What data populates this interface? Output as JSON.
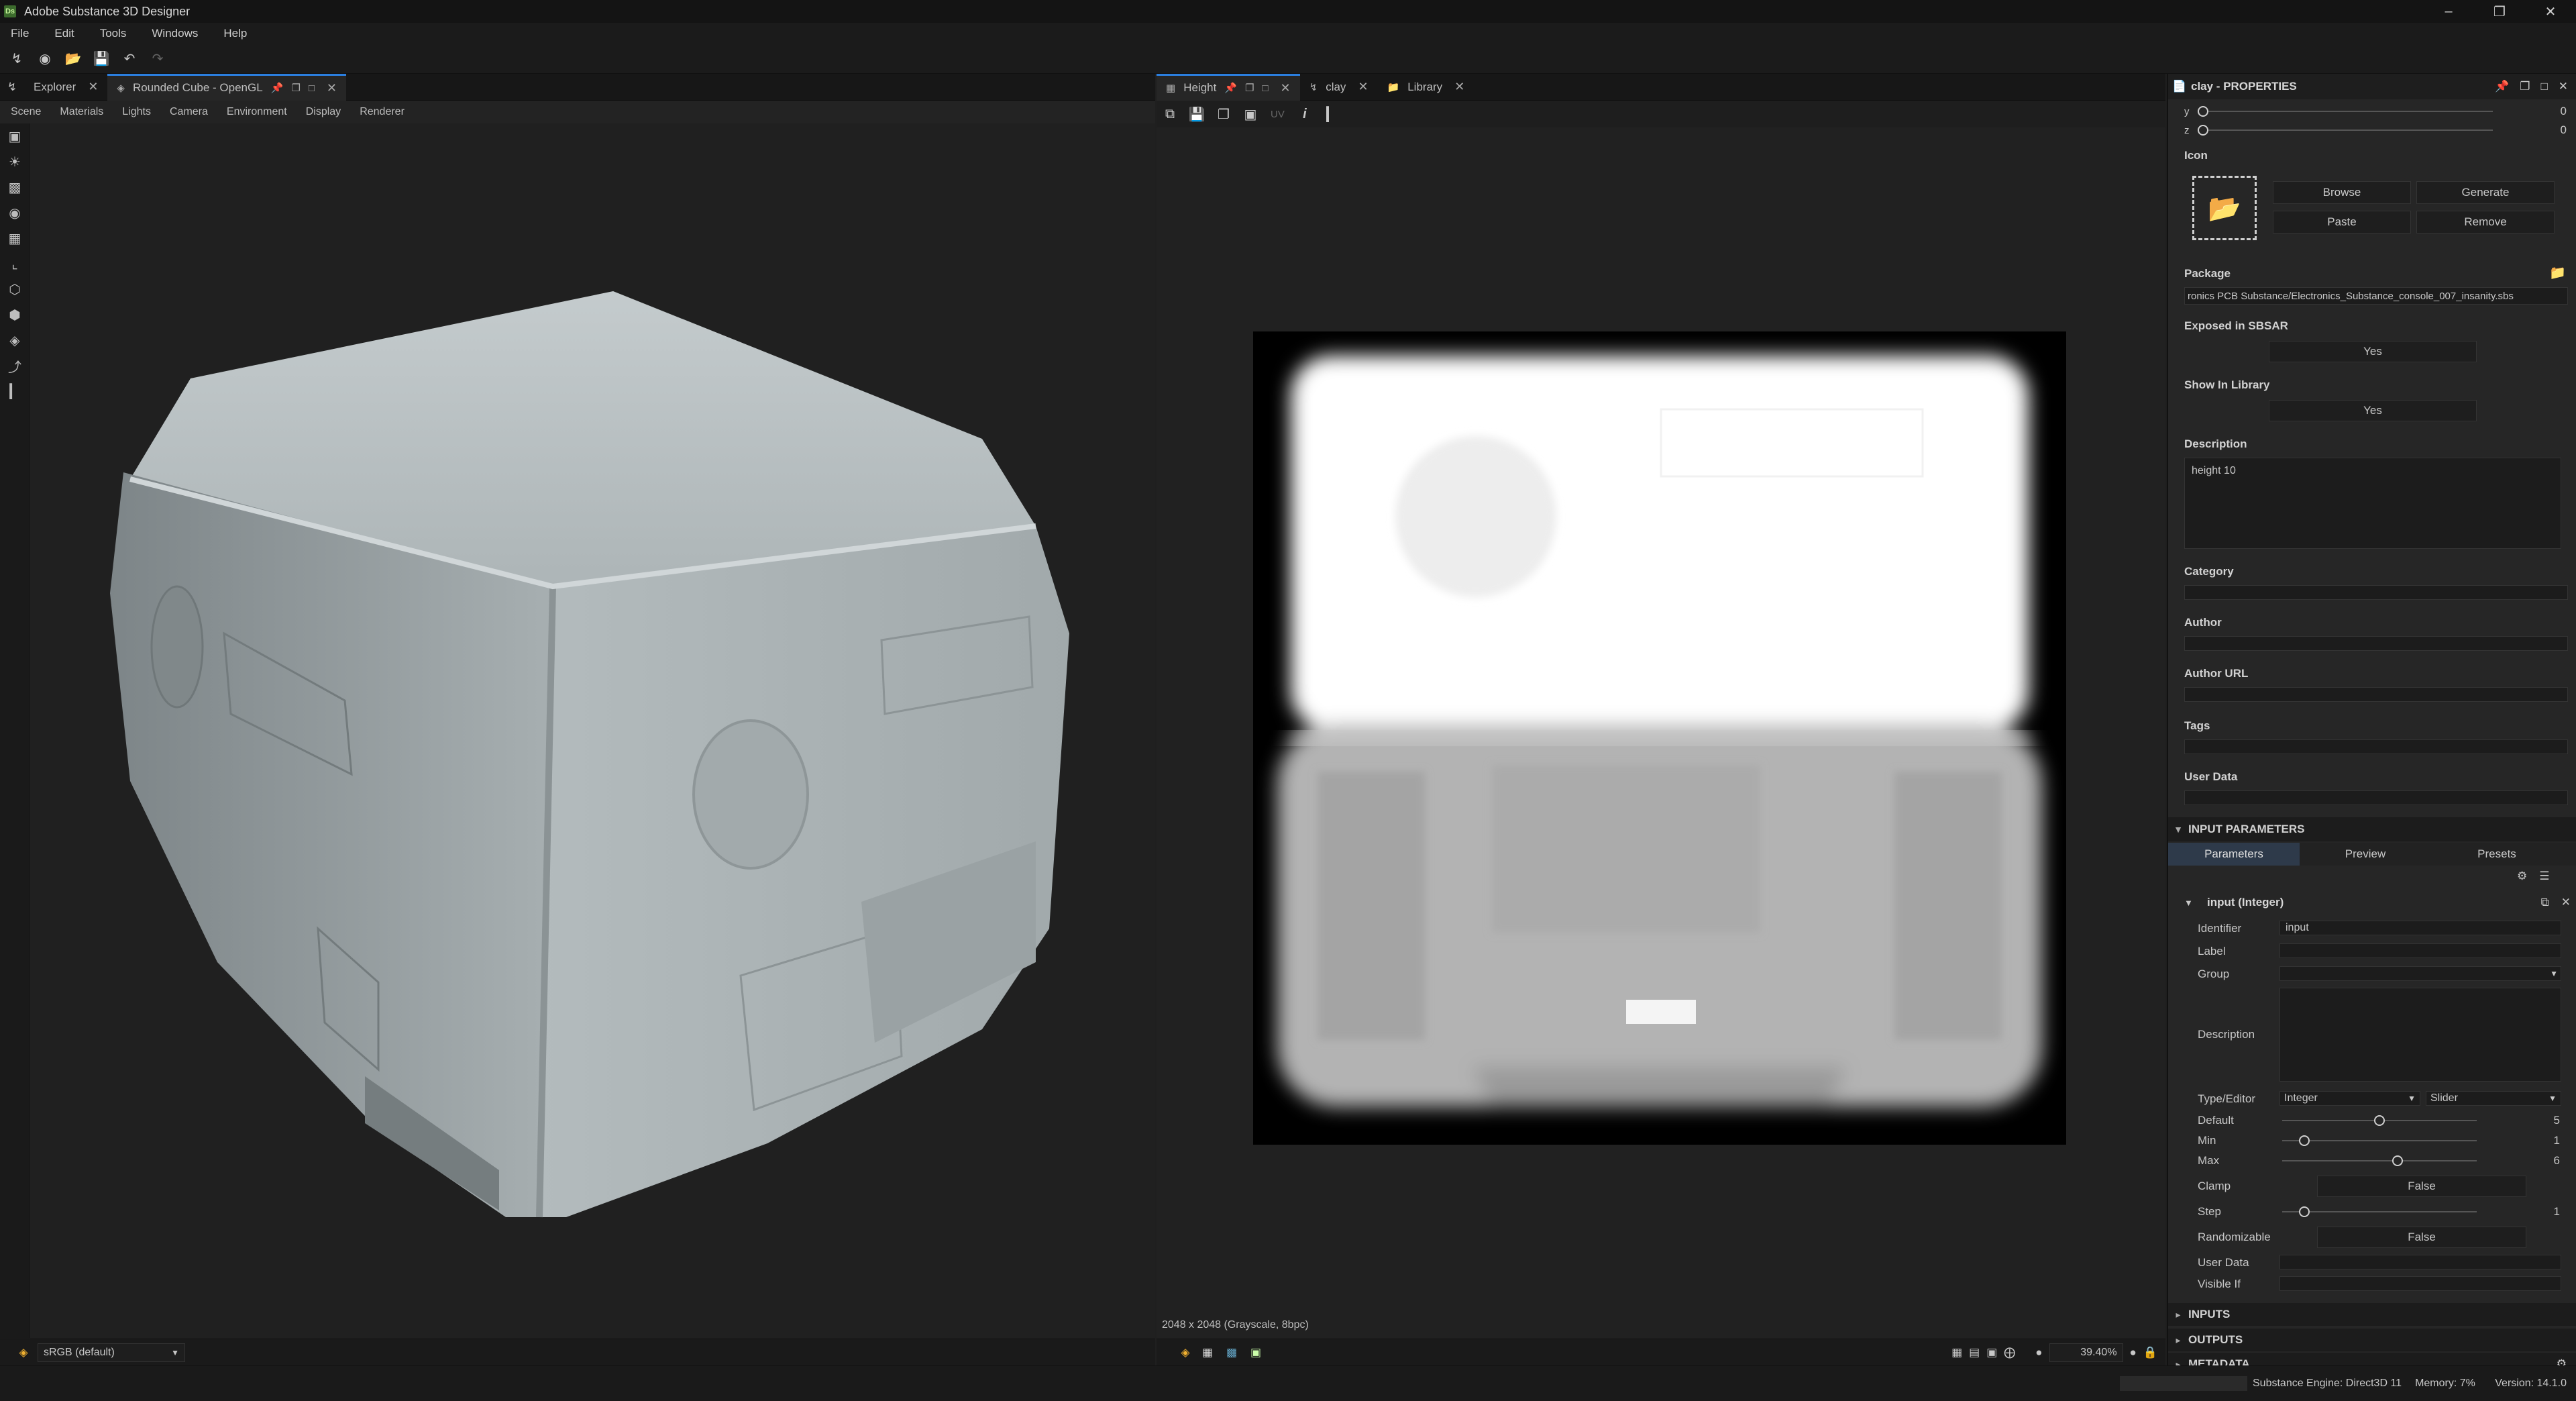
{
  "app": {
    "title": "Adobe Substance 3D Designer",
    "logo_text": "Ds"
  },
  "menu": [
    "File",
    "Edit",
    "Tools",
    "Windows",
    "Help"
  ],
  "viewer3d": {
    "tabs": [
      {
        "label": "Explorer"
      },
      {
        "label": "Rounded Cube - OpenGL"
      }
    ],
    "menu": [
      "Scene",
      "Materials",
      "Lights",
      "Camera",
      "Environment",
      "Display",
      "Renderer"
    ],
    "colorspace": "sRGB (default)"
  },
  "viewer2d": {
    "tabs": [
      {
        "label": "Height"
      },
      {
        "label": "clay"
      },
      {
        "label": "Library"
      }
    ],
    "uv_label": "UV",
    "info": "2048 x 2048 (Grayscale, 8bpc)",
    "zoom": "39.40%"
  },
  "properties": {
    "title": "clay - PROPERTIES",
    "coords": [
      {
        "axis": "y",
        "value": "0"
      },
      {
        "axis": "z",
        "value": "0"
      }
    ],
    "icon_label": "Icon",
    "icon_buttons": {
      "browse": "Browse",
      "generate": "Generate",
      "paste": "Paste",
      "remove": "Remove"
    },
    "package_label": "Package",
    "package_value": "ronics PCB Substance/Electronics_Substance_console_007_insanity.sbs",
    "exposed_label": "Exposed in SBSAR",
    "exposed_value": "Yes",
    "show_library_label": "Show In Library",
    "show_library_value": "Yes",
    "description_label": "Description",
    "description_value": "height 10",
    "category_label": "Category",
    "author_label": "Author",
    "author_url_label": "Author URL",
    "tags_label": "Tags",
    "user_data_label": "User Data",
    "input_params": {
      "header": "INPUT PARAMETERS",
      "tabs": [
        "Parameters",
        "Preview",
        "Presets"
      ],
      "param_header": "input (Integer)",
      "identifier_label": "Identifier",
      "identifier_value": "input",
      "label_label": "Label",
      "group_label": "Group",
      "description_label": "Description",
      "type_editor_label": "Type/Editor",
      "type_value": "Integer",
      "editor_value": "Slider",
      "default_label": "Default",
      "default_value": "5",
      "default_fraction": 0.5,
      "min_label": "Min",
      "min_value": "1",
      "min_fraction": 0.09,
      "max_label": "Max",
      "max_value": "6",
      "max_fraction": 0.6,
      "clamp_label": "Clamp",
      "clamp_value": "False",
      "step_label": "Step",
      "step_value": "1",
      "step_fraction": 0.09,
      "randomizable_label": "Randomizable",
      "randomizable_value": "False",
      "user_data_label": "User Data",
      "visible_if_label": "Visible If"
    },
    "sections": [
      "INPUTS",
      "OUTPUTS",
      "METADATA"
    ]
  },
  "status": {
    "engine": "Substance Engine: Direct3D 11",
    "memory": "Memory: 7%",
    "version": "Version: 14.1.0"
  }
}
